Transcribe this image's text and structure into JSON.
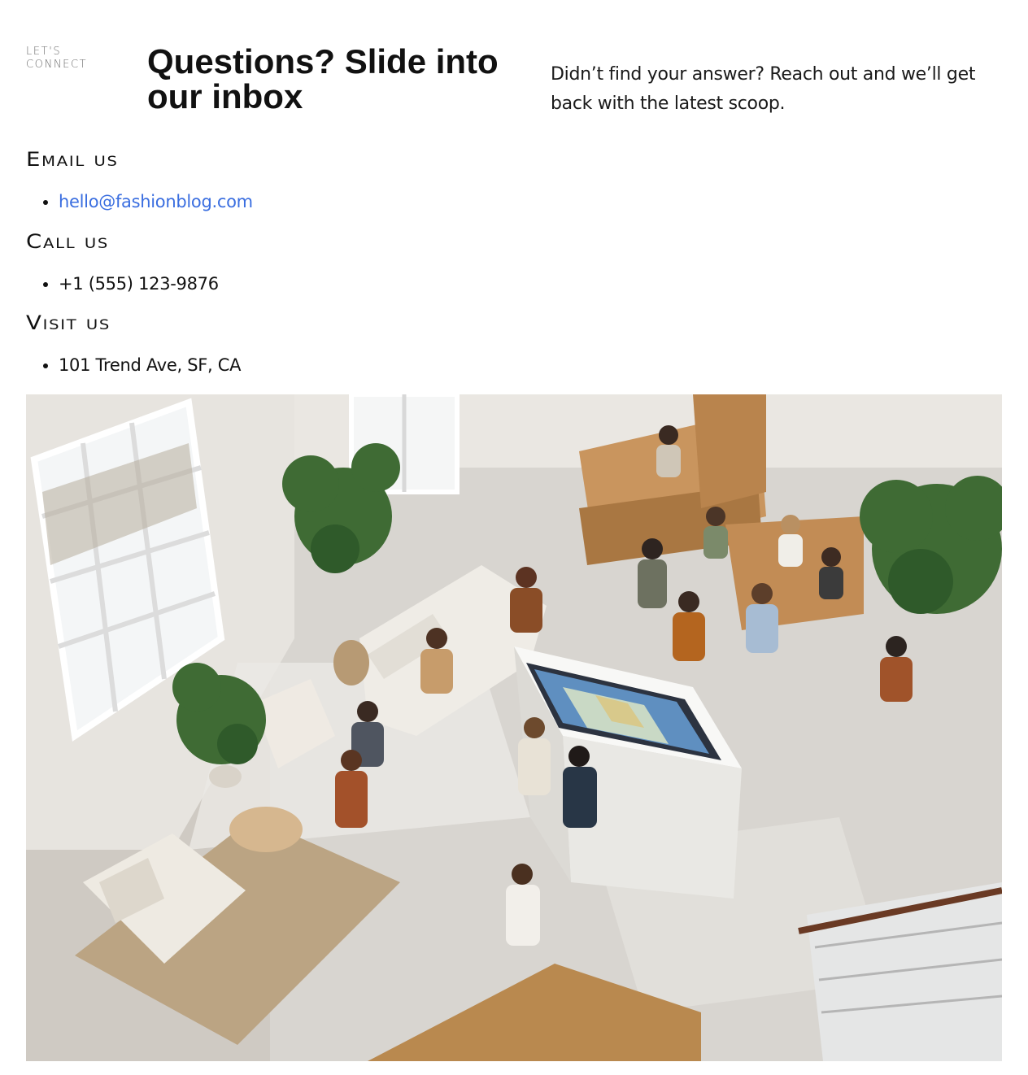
{
  "contact": {
    "eyebrow": "LET'S CONNECT",
    "title": "Questions? Slide into our inbox",
    "intro": "Didn’t find your answer? Reach out and we’ll get back with the latest scoop.",
    "email": {
      "heading": "Email us",
      "value": "hello@fashionblog.com"
    },
    "phone": {
      "heading": "Call us",
      "value": "+1 (555) 123-9876"
    },
    "visit": {
      "heading": "Visit us",
      "value": "101 Trend Ave, SF, CA"
    }
  },
  "colors": {
    "link": "#3a6ee0",
    "text": "#111111",
    "muted": "#6b6b6b"
  }
}
